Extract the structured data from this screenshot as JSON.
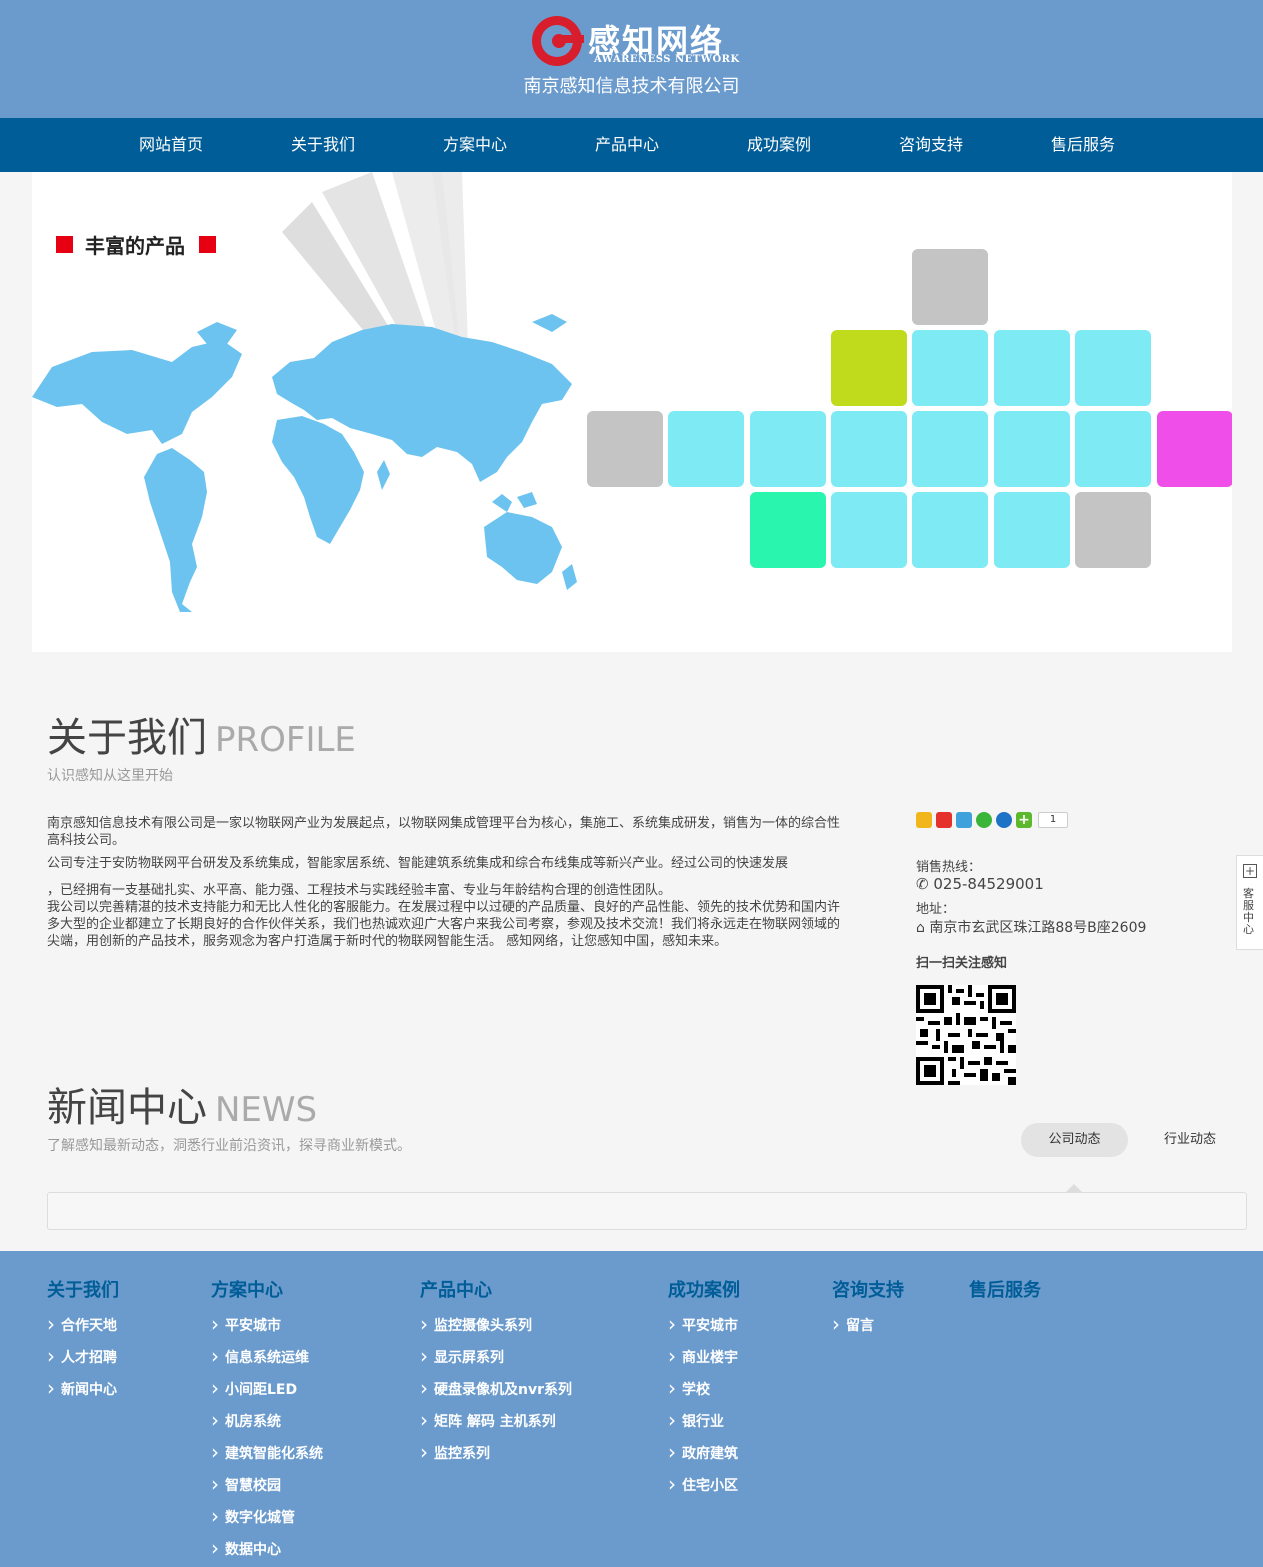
{
  "header": {
    "logo_cn": "感知网络",
    "logo_en": "AWARENESS NETWORK",
    "company": "南京感知信息技术有限公司"
  },
  "nav": [
    "网站首页",
    "关于我们",
    "方案中心",
    "产品中心",
    "成功案例",
    "咨询支持",
    "售后服务"
  ],
  "banner": {
    "title": "丰富的产品"
  },
  "about": {
    "title": "关于我们",
    "title_en": "PROFILE",
    "subtitle": "认识感知从这里开始",
    "p1": " 南京感知信息技术有限公司是一家以物联网产业为发展起点，以物联网集成管理平台为核心，集施工、系统集成研发，销售为一体的综合性高科技公司。",
    "p2": "公司专注于安防物联网平台研发及系统集成，智能家居系统、智能建筑系统集成和综合布线集成等新兴产业。经过公司的快速发展",
    "p3": "，已经拥有一支基础扎实、水平高、能力强、工程技术与实践经验丰富、专业与年龄结构合理的创造性团队。",
    "p4": "我公司以完善精湛的技术支持能力和无比人性化的客服能力。在发展过程中以过硬的产品质量、良好的产品性能、领先的技术优势和国内许多大型的企业都建立了长期良好的合作伙伴关系，我们也热诚欢迎广大客户来我公司考察，参观及技术交流！我们将永远走在物联网领域的尖端，用创新的产品技术，服务观念为客户打造属于新时代的物联网智能生活。 感知网络，让您感知中国，感知未来。"
  },
  "share": {
    "count": "1",
    "icons": [
      "qzone-icon",
      "weibo-icon",
      "tencent-weibo-icon",
      "wechat-icon",
      "renren-icon",
      "more-share-icon"
    ]
  },
  "contact": {
    "hotline_label": "销售热线：",
    "phone": "025-84529001",
    "address_label": "地址：",
    "address": "南京市玄武区珠江路88号B座2609",
    "qr_label": "扫一扫关注感知"
  },
  "news": {
    "title": "新闻中心",
    "title_en": "NEWS",
    "subtitle": "了解感知最新动态，洞悉行业前沿资讯，探寻商业新模式。",
    "tabs": [
      "公司动态",
      "行业动态"
    ]
  },
  "footer": {
    "columns": [
      {
        "title": "关于我们",
        "items": [
          "合作天地",
          "人才招聘",
          "新闻中心"
        ]
      },
      {
        "title": "方案中心",
        "items": [
          "平安城市",
          "信息系统运维",
          "小间距LED",
          "机房系统",
          "建筑智能化系统",
          "智慧校园",
          "数字化城管",
          "数据中心"
        ]
      },
      {
        "title": "产品中心",
        "items": [
          "监控摄像头系列",
          "显示屏系列",
          "硬盘录像机及nvr系列",
          "矩阵 解码 主机系列",
          "监控系列"
        ]
      },
      {
        "title": "成功案例",
        "items": [
          "平安城市",
          "商业楼宇",
          "学校",
          "银行业",
          "政府建筑",
          "住宅小区"
        ]
      },
      {
        "title": "咨询支持",
        "items": [
          "留言"
        ]
      },
      {
        "title": "售后服务",
        "items": []
      }
    ]
  },
  "side_widget": {
    "label": "客服中心"
  },
  "colors": {
    "header_bg": "#6b9bcd",
    "nav_bg": "#005d97",
    "logo_red": "#d81e2c",
    "tile_cyan": "#7deaf4",
    "tile_gray": "#c4c4c4",
    "tile_lime": "#c0da1c",
    "tile_magenta": "#ef4fe8",
    "tile_green": "#2af5ae",
    "map_blue": "#6cc3ef"
  }
}
